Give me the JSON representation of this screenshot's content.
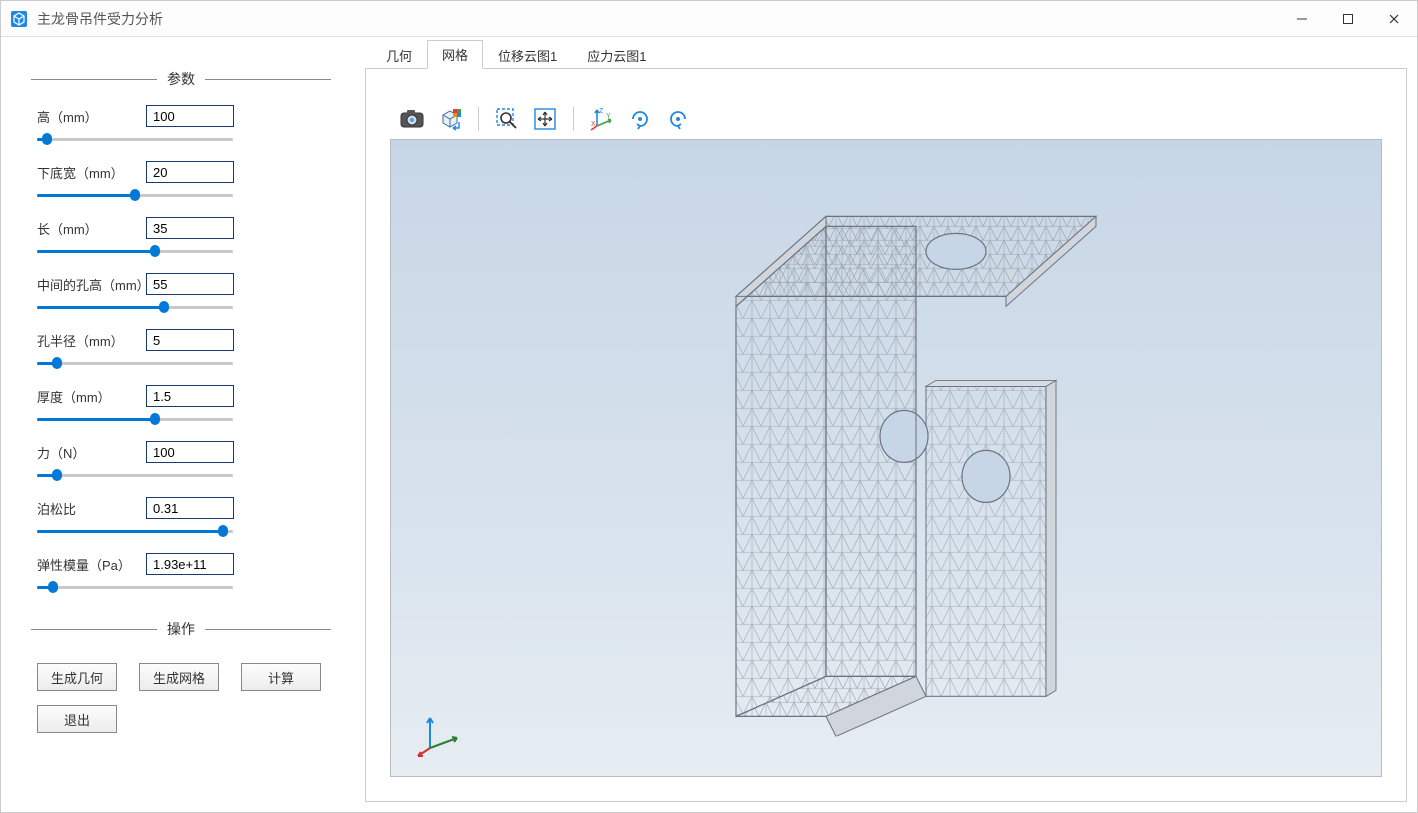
{
  "window": {
    "title": "主龙骨吊件受力分析"
  },
  "sidebar": {
    "section_params": "参数",
    "section_ops": "操作",
    "params": [
      {
        "label": "高（mm）",
        "value": "100",
        "pos": 5
      },
      {
        "label": "下底宽（mm）",
        "value": "20",
        "pos": 50
      },
      {
        "label": "长（mm）",
        "value": "35",
        "pos": 60
      },
      {
        "label": "中间的孔高（mm）",
        "value": "55",
        "pos": 65
      },
      {
        "label": "孔半径（mm）",
        "value": "5",
        "pos": 10
      },
      {
        "label": "厚度（mm）",
        "value": "1.5",
        "pos": 60
      },
      {
        "label": "力（N）",
        "value": "100",
        "pos": 10
      },
      {
        "label": "泊松比",
        "value": "0.31",
        "pos": 95
      },
      {
        "label": "弹性模量（Pa）",
        "value": "1.93e+11",
        "pos": 8
      }
    ],
    "buttons": {
      "gen_geom": "生成几何",
      "gen_mesh": "生成网格",
      "compute": "计算",
      "exit": "退出"
    }
  },
  "tabs": {
    "items": [
      {
        "label": "几何",
        "active": false
      },
      {
        "label": "网格",
        "active": true
      },
      {
        "label": "位移云图1",
        "active": false
      },
      {
        "label": "应力云图1",
        "active": false
      }
    ]
  },
  "toolbar": {
    "icons": [
      "camera-icon",
      "view-cube-icon",
      "zoom-box-icon",
      "fit-screen-icon",
      "axes-icon",
      "rotate-cw-icon",
      "rotate-ccw-icon"
    ]
  },
  "colors": {
    "accent": "#0078d7",
    "canvas_top": "#c7d6e6",
    "canvas_bottom": "#e6edf3",
    "mesh_edge": "#9aa0a6"
  }
}
